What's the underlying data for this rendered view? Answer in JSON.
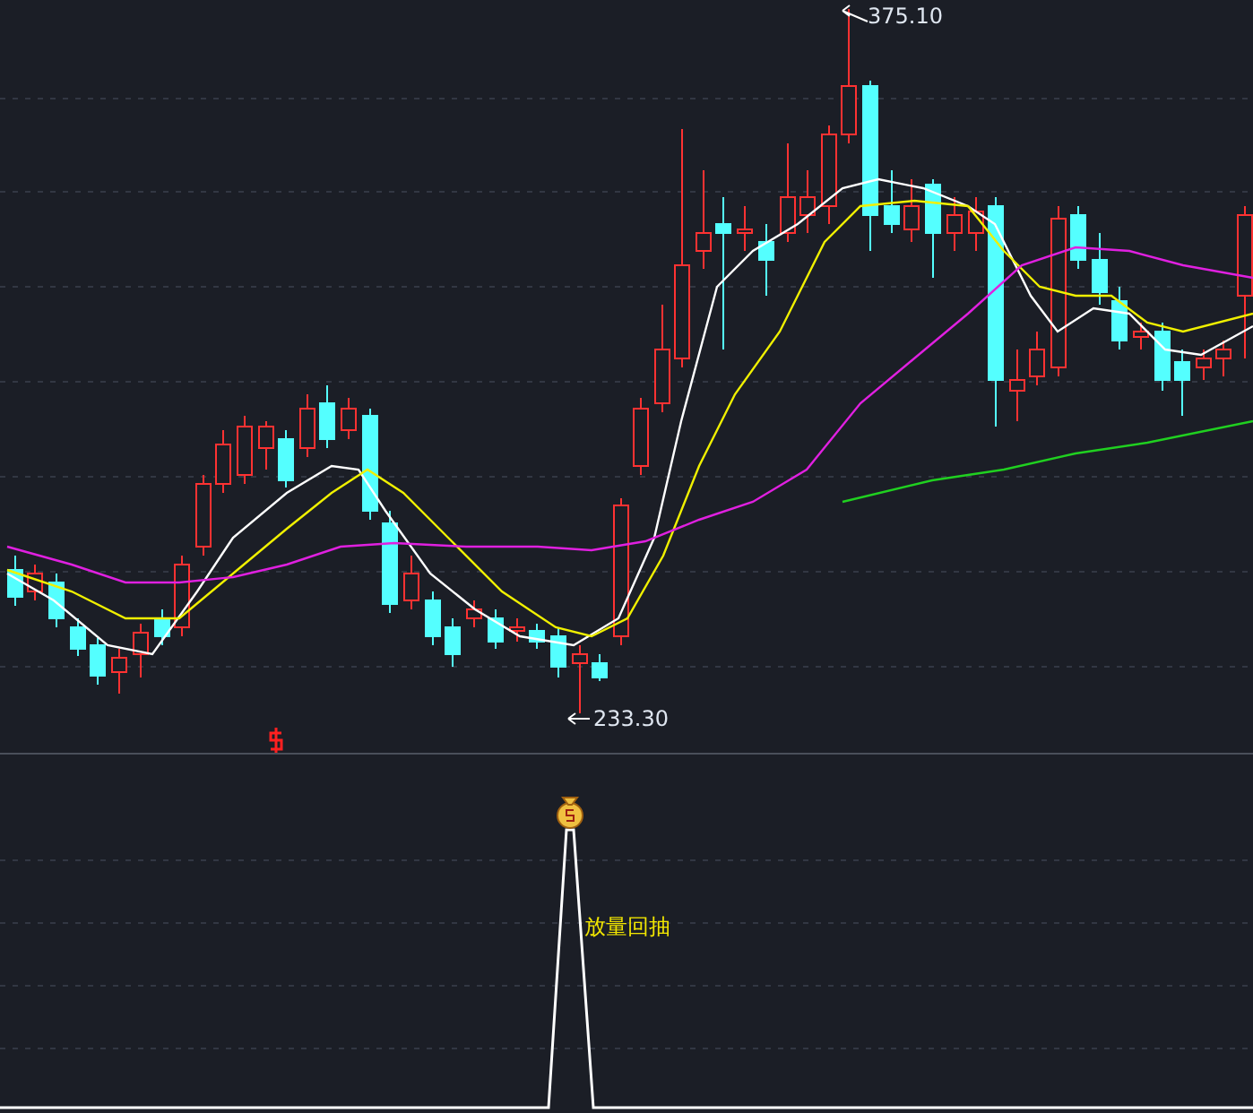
{
  "price_chart": {
    "high_label": "375.10",
    "low_label": "233.30"
  },
  "indicator_panel": {
    "signal_label": "放量回抽"
  }
}
